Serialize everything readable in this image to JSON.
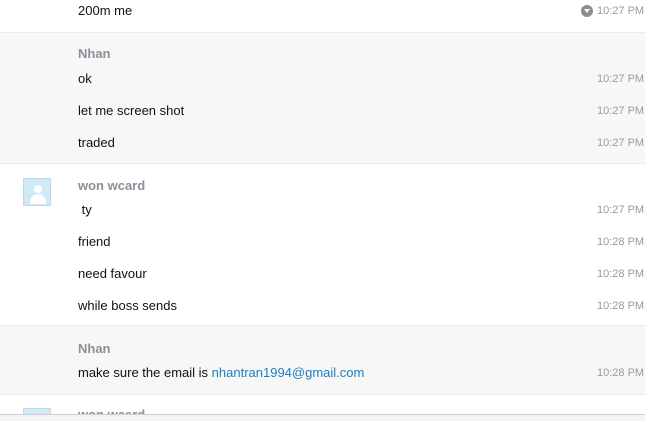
{
  "groups": [
    {
      "sender": "",
      "messages": [
        {
          "text": "200m me",
          "time": "10:27 PM"
        }
      ]
    },
    {
      "sender": "Nhan",
      "messages": [
        {
          "text": "ok",
          "time": "10:27 PM"
        },
        {
          "text": "let me screen shot",
          "time": "10:27 PM"
        },
        {
          "text": "traded",
          "time": "10:27 PM"
        }
      ]
    },
    {
      "sender": "won wcard",
      "messages": [
        {
          "text": " ty",
          "time": "10:27 PM"
        },
        {
          "text": "friend",
          "time": "10:28 PM"
        },
        {
          "text": "need favour",
          "time": "10:28 PM"
        },
        {
          "text": "while boss sends",
          "time": "10:28 PM"
        }
      ]
    },
    {
      "sender": "Nhan",
      "messages": [
        {
          "text": "make sure the email is ",
          "link": "nhantran1994@gmail.com",
          "time": "10:28 PM"
        }
      ]
    },
    {
      "sender": "won wcard",
      "messages": []
    }
  ],
  "icons": {
    "clock": "clock-icon",
    "avatar": "user-avatar-placeholder"
  },
  "colors": {
    "link": "#1a7fc1",
    "sender": "#8a8f98",
    "alt_background": "#f7f7f7",
    "avatar_background": "#cfe9f6"
  }
}
